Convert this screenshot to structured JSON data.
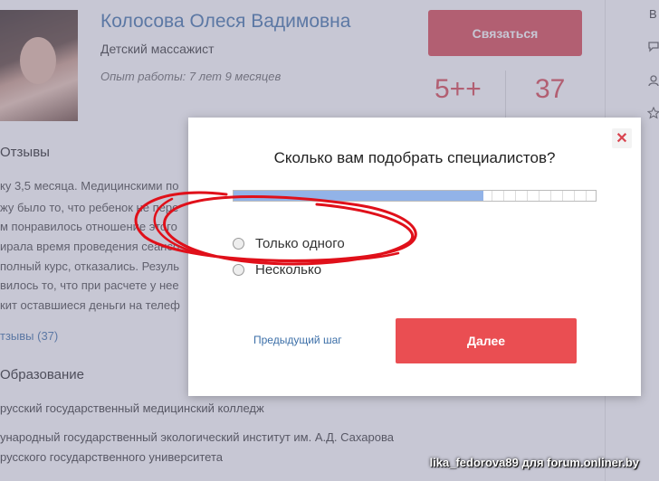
{
  "profile": {
    "name": "Колосова Олеся Вадимовна",
    "role": "Детский массажист",
    "experience": "Опыт работы: 7 лет 9 месяцев",
    "contact_label": "Связаться",
    "stat_rating": "5++",
    "stat_reviews": "37"
  },
  "sidebar_right": {
    "initial": "В"
  },
  "reviews": {
    "title": "Отзывы",
    "lines": [
      "ку 3,5 месяца. Медицинскими по",
      "жу было то, что ребенок не пере",
      "м понравилось отношение этого",
      "ирала время проведения сеансо",
      "полный курс, отказались. Резуль",
      "вилось то, что при расчете у нее",
      "кит оставшиеся деньги на телеф"
    ],
    "all_link": "тзывы (37)"
  },
  "education": {
    "title": "Образование",
    "lines": [
      "русский государственный медицинский колледж",
      "ународный государственный экологический институт им. А.Д. Сахарова",
      "русского государственного университета"
    ]
  },
  "modal": {
    "question": "Сколько вам подобрать специалистов?",
    "progress": 0.69,
    "options": [
      "Только одного",
      "Несколько"
    ],
    "prev_label": "Предыдущий шаг",
    "next_label": "Далее",
    "close_symbol": "✕"
  },
  "watermark": "lika_fedorova89 для forum.onliner.by",
  "colors": {
    "accent_red": "#d9434e",
    "link_blue": "#3c6fa8",
    "progress_blue": "#92b3e8",
    "annotation_red": "#e0101a"
  }
}
